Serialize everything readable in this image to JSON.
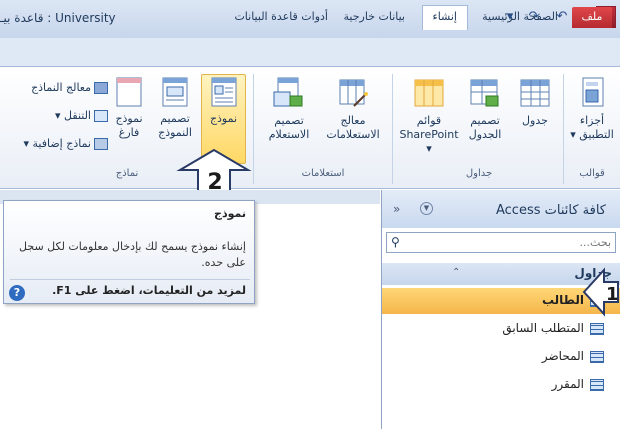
{
  "titlebar": {
    "title": "University : قاعدة بيـ",
    "app_icon_letter": "A",
    "qat": [
      "save-icon",
      "undo-icon",
      "redo-icon",
      "customize-icon"
    ]
  },
  "tabs": {
    "file": "ملف",
    "items": [
      "الصفحة الرئيسية",
      "إنشاء",
      "بيانات خارجية",
      "أدوات قاعدة البيانات"
    ],
    "active": "إنشاء"
  },
  "ribbon": {
    "groups": {
      "templates": {
        "label": "قوالب",
        "app_parts": "أجزاء التطبيق"
      },
      "tables": {
        "label": "جداول",
        "table": "جدول",
        "table_design": "تصميم الجدول",
        "sharepoint_lists": "قوائم SharePoint"
      },
      "queries": {
        "label": "استعلامات",
        "query_wizard": "معالج الاستعلامات",
        "query_design": "تصميم الاستعلام"
      },
      "forms": {
        "label": "نماذج",
        "form": "نموذج",
        "form_design": "تصميم النموذج",
        "blank_form": "نموذج فارغ",
        "form_wizard": "معالج النماذج",
        "navigation": "التنقل",
        "more_forms": "نماذج إضافية"
      }
    }
  },
  "callouts": {
    "first": "1",
    "second": "2"
  },
  "tooltip": {
    "title": "نموذج",
    "body": "إنشاء نموذج يسمح لك بإدخال معلومات لكل سجل على حده.",
    "help": "لمزيد من التعليمات، اضغط على F1."
  },
  "navpane": {
    "title": "كافة كائنات Access",
    "search_placeholder": "بحث...",
    "group_title": "جداول",
    "items": [
      "الطالب",
      "المتطلب السابق",
      "المحاضر",
      "المقرر"
    ],
    "selected": "الطالب"
  }
}
